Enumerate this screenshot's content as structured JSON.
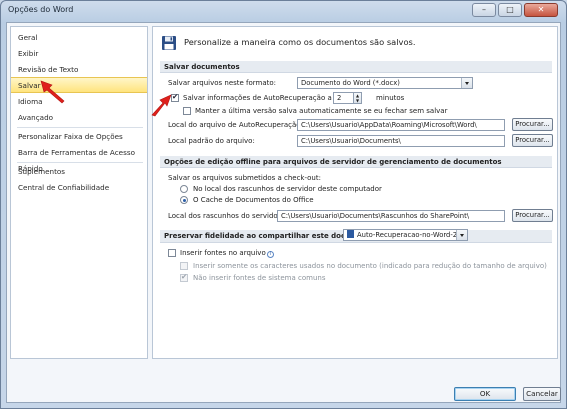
{
  "window": {
    "title": "Opções do Word",
    "minimize": "–",
    "maximize": "□",
    "close": "✕"
  },
  "sidebar": {
    "items": [
      {
        "label": "Geral"
      },
      {
        "label": "Exibir"
      },
      {
        "label": "Revisão de Texto"
      },
      {
        "label": "Salvar",
        "selected": true
      },
      {
        "label": "Idioma"
      },
      {
        "label": "Avançado"
      },
      {
        "label": "Personalizar Faixa de Opções"
      },
      {
        "label": "Barra de Ferramentas de Acesso Rápido"
      },
      {
        "label": "Suplementos"
      },
      {
        "label": "Central de Confiabilidade"
      }
    ]
  },
  "header": {
    "text": "Personalize a maneira como os documentos são salvos.",
    "icon": "floppy-disk-icon"
  },
  "save_documents": {
    "title": "Salvar documentos",
    "format_label": "Salvar arquivos neste formato:",
    "format_value": "Documento do Word (*.docx)",
    "autorecover_label": "Salvar informações de AutoRecuperação a cada",
    "autorecover_checked": true,
    "autorecover_minutes": "2",
    "minutes_label": "minutos",
    "keep_last_label": "Manter a última versão salva automaticamente se eu fechar sem salvar",
    "keep_last_checked": false,
    "autorecover_location_label": "Local do arquivo de AutoRecuperação:",
    "autorecover_location_value": "C:\\Users\\Usuario\\AppData\\Roaming\\Microsoft\\Word\\",
    "default_location_label": "Local padrão do arquivo:",
    "default_location_value": "C:\\Users\\Usuario\\Documents\\",
    "browse_label": "Procurar..."
  },
  "offline": {
    "title": "Opções de edição offline para arquivos de servidor de gerenciamento de documentos",
    "checkout_label": "Salvar os arquivos submetidos a check-out:",
    "option_server": "No local dos rascunhos de servidor deste computador",
    "option_cache": "O Cache de Documentos do Office",
    "selected": "cache",
    "drafts_label": "Local dos rascunhos do servidor:",
    "drafts_value": "C:\\Users\\Usuario\\Documents\\Rascunhos do SharePoint\\",
    "browse_label": "Procurar..."
  },
  "fidelity": {
    "title": "Preservar fidelidade ao compartilhar este documento:",
    "document_value": "Auto-Recuperacao-no-Word-2010",
    "embed_fonts_label": "Inserir fontes no arquivo",
    "embed_chars_label": "Inserir somente os caracteres usados no documento (indicado para redução do tamanho de arquivo)",
    "no_system_fonts_label": "Não inserir fontes de sistema comuns",
    "no_system_fonts_checked": true
  },
  "footer": {
    "ok_label": "OK",
    "cancel_label": "Cancelar"
  },
  "colors": {
    "selected_bg": "#ffe47e",
    "annotation_arrow": "#e0201c"
  }
}
